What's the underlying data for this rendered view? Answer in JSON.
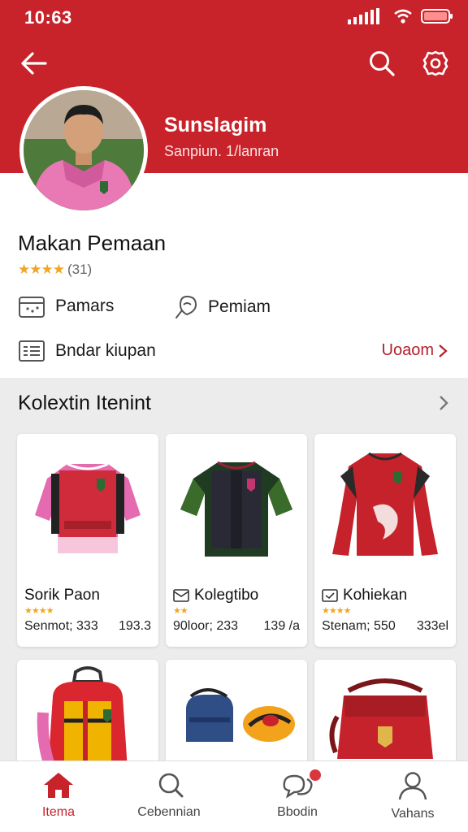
{
  "status_bar": {
    "time": "10:63"
  },
  "profile": {
    "name": "Sunslagim",
    "subtitle": "Sanpiun. 1/lanran"
  },
  "info": {
    "title": "Makan Pemaan",
    "rating_count": "(31)",
    "items": [
      {
        "label": "Pamars",
        "icon": "calendar-icon"
      },
      {
        "label": "Pemiam",
        "icon": "location-icon"
      },
      {
        "label": "Bndar kiupan",
        "icon": "list-icon"
      }
    ],
    "see_all": "Uoaom"
  },
  "collection": {
    "title": "Kolextin Itenint",
    "items": [
      {
        "title": "Sorik Paon",
        "meta": "Senmot; 333",
        "price": "193.3",
        "stars": "★★★★",
        "icon": ""
      },
      {
        "title": "Kolegtibo",
        "meta": "90loor; 233",
        "price": "139 /a",
        "stars": "★★",
        "icon": "mail-icon"
      },
      {
        "title": "Kohiekan",
        "meta": "Stenam; 550",
        "price": "333el",
        "stars": "★★★★",
        "icon": "check-icon"
      }
    ]
  },
  "bottom_nav": [
    {
      "label": "Itema",
      "icon": "home-icon",
      "active": true
    },
    {
      "label": "Cebennian",
      "icon": "search-icon",
      "active": false
    },
    {
      "label": "Bbodin",
      "icon": "chat-icon",
      "active": false
    },
    {
      "label": "Vahans",
      "icon": "person-icon",
      "active": false
    }
  ],
  "colors": {
    "brand": "#c8232a",
    "star": "#f0a623"
  }
}
